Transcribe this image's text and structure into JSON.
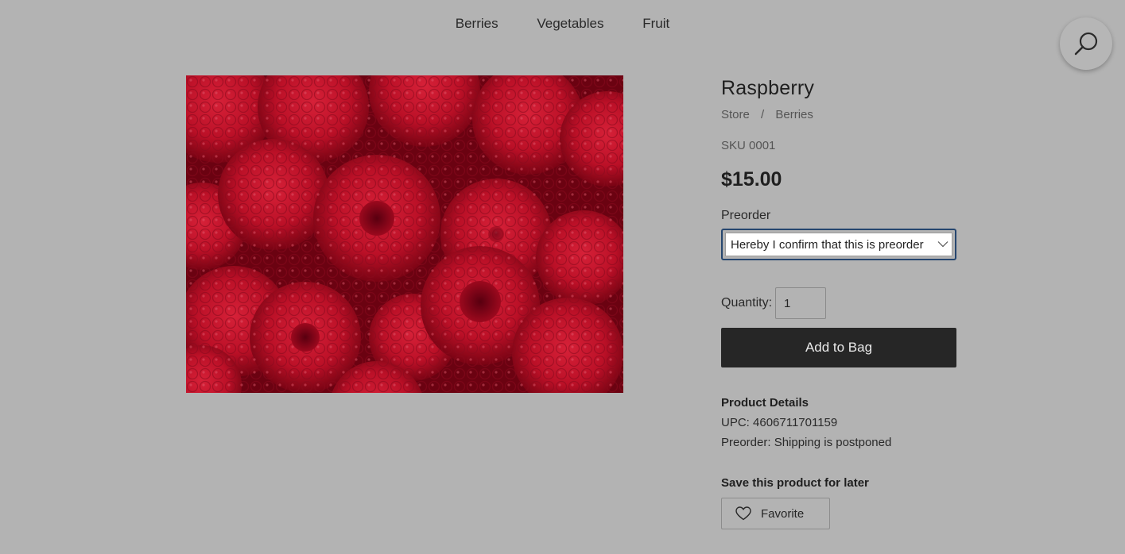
{
  "nav": {
    "items": [
      "Berries",
      "Vegetables",
      "Fruit"
    ]
  },
  "search": {
    "icon": "search-icon"
  },
  "product": {
    "image": {
      "subject": "raspberries"
    },
    "title": "Raspberry",
    "breadcrumb": [
      "Store",
      "Berries"
    ],
    "breadcrumb_separator": "/",
    "sku": "SKU 0001",
    "price": "$15.00",
    "preorder": {
      "label": "Preorder",
      "selected_value": "Hereby I confirm that this is preorder"
    },
    "quantity": {
      "label": "Quantity:",
      "value": "1"
    },
    "add_to_bag_label": "Add to Bag",
    "details": {
      "heading": "Product Details",
      "upc": "UPC: 4606711701159",
      "preorder_note": "Preorder: Shipping is postponed"
    },
    "save": {
      "heading": "Save this product for later",
      "favorite_label": "Favorite"
    }
  },
  "colors": {
    "page_background": "#b3b3b3",
    "button_dark": "#262626",
    "focus_border": "#26466f"
  }
}
